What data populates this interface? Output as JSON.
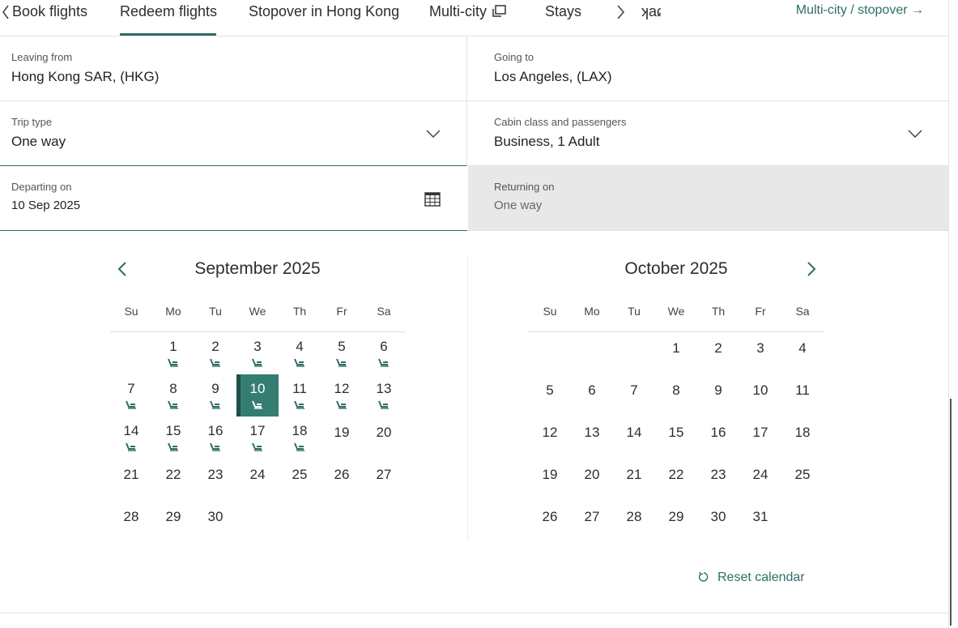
{
  "tabs": {
    "items": [
      {
        "label": "Book flights"
      },
      {
        "label": "Redeem flights"
      },
      {
        "label": "Stopover in Hong Kong"
      },
      {
        "label": "Multi-city"
      },
      {
        "label": "Stays"
      },
      {
        "label": "ʞaɕ"
      }
    ],
    "active": "Redeem flights",
    "multi_link": "Multi-city / stopover →"
  },
  "form": {
    "leaving": {
      "label": "Leaving from",
      "value": "Hong Kong SAR, (HKG)"
    },
    "going": {
      "label": "Going to",
      "value": "Los Angeles, (LAX)"
    },
    "trip_type": {
      "label": "Trip type",
      "value": "One way"
    },
    "cabin": {
      "label": "Cabin class and passengers",
      "value": "Business, 1 Adult"
    },
    "departing": {
      "label": "Departing on",
      "value": "10 Sep 2025"
    },
    "returning": {
      "label": "Returning on",
      "value": "One way"
    }
  },
  "calendar": {
    "weekdays": [
      "Su",
      "Mo",
      "Tu",
      "We",
      "Th",
      "Fr",
      "Sa"
    ],
    "months": [
      {
        "title": "September 2025",
        "first_weekday": 1,
        "days": 30,
        "award_days": [
          1,
          2,
          3,
          4,
          5,
          6,
          7,
          8,
          9,
          10,
          11,
          12,
          13,
          14,
          15,
          16,
          17,
          18
        ],
        "selected": 10
      },
      {
        "title": "October 2025",
        "first_weekday": 3,
        "days": 31,
        "award_days": [],
        "selected": null
      }
    ],
    "reset_label": "Reset calendar",
    "accent": "#2e6e67",
    "selected_bg": "#357d72"
  }
}
